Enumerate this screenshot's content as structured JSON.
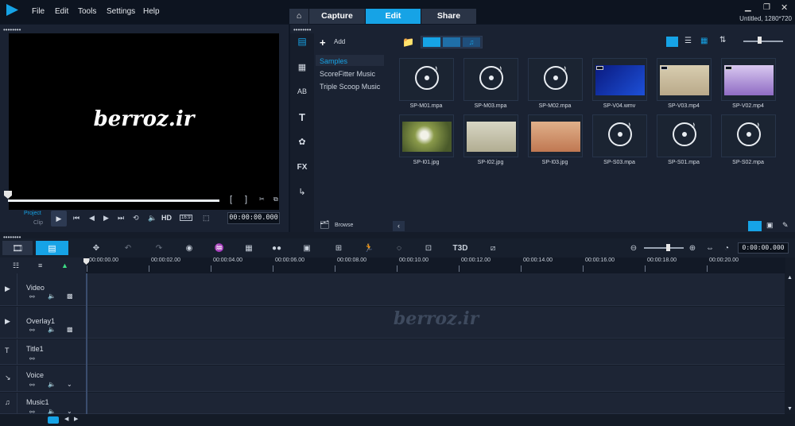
{
  "app": {
    "title": "Untitled, 1280*720",
    "accent": "#16a3e6"
  },
  "menu": [
    "File",
    "Edit",
    "Tools",
    "Settings",
    "Help"
  ],
  "tabs": [
    {
      "label": "Capture"
    },
    {
      "label": "Edit"
    },
    {
      "label": "Share"
    }
  ],
  "preview": {
    "watermark": "berroz.ir",
    "project_label": "Project",
    "clip_label": "Clip",
    "hd": "HD",
    "aspect": "16:9",
    "timecode": "00:00:00.000"
  },
  "library": {
    "add_label": "Add",
    "browse_label": "Browse",
    "categories": [
      "Samples",
      "ScoreFitter Music",
      "Triple Scoop Music"
    ],
    "items": [
      "SP-M01.mpa",
      "SP-M03.mpa",
      "SP-M02.mpa",
      "SP-V04.wmv",
      "SP-V03.mp4",
      "SP-V02.mp4",
      "SP-I01.jpg",
      "SP-I02.jpg",
      "SP-I03.jpg",
      "SP-S03.mpa",
      "SP-S01.mpa",
      "SP-S02.mpa"
    ]
  },
  "timeline": {
    "timecode": "0:00:00.000",
    "watermark": "berroz.ir",
    "ticks": [
      "00:00:00.00",
      "00:00:02.00",
      "00:00:04.00",
      "00:00:06.00",
      "00:00:08.00",
      "00:00:10.00",
      "00:00:12.00",
      "00:00:14.00",
      "00:00:16.00",
      "00:00:18.00",
      "00:00:20.00"
    ],
    "tracks": [
      "Video",
      "Overlay1",
      "Title1",
      "Voice",
      "Music1"
    ]
  }
}
